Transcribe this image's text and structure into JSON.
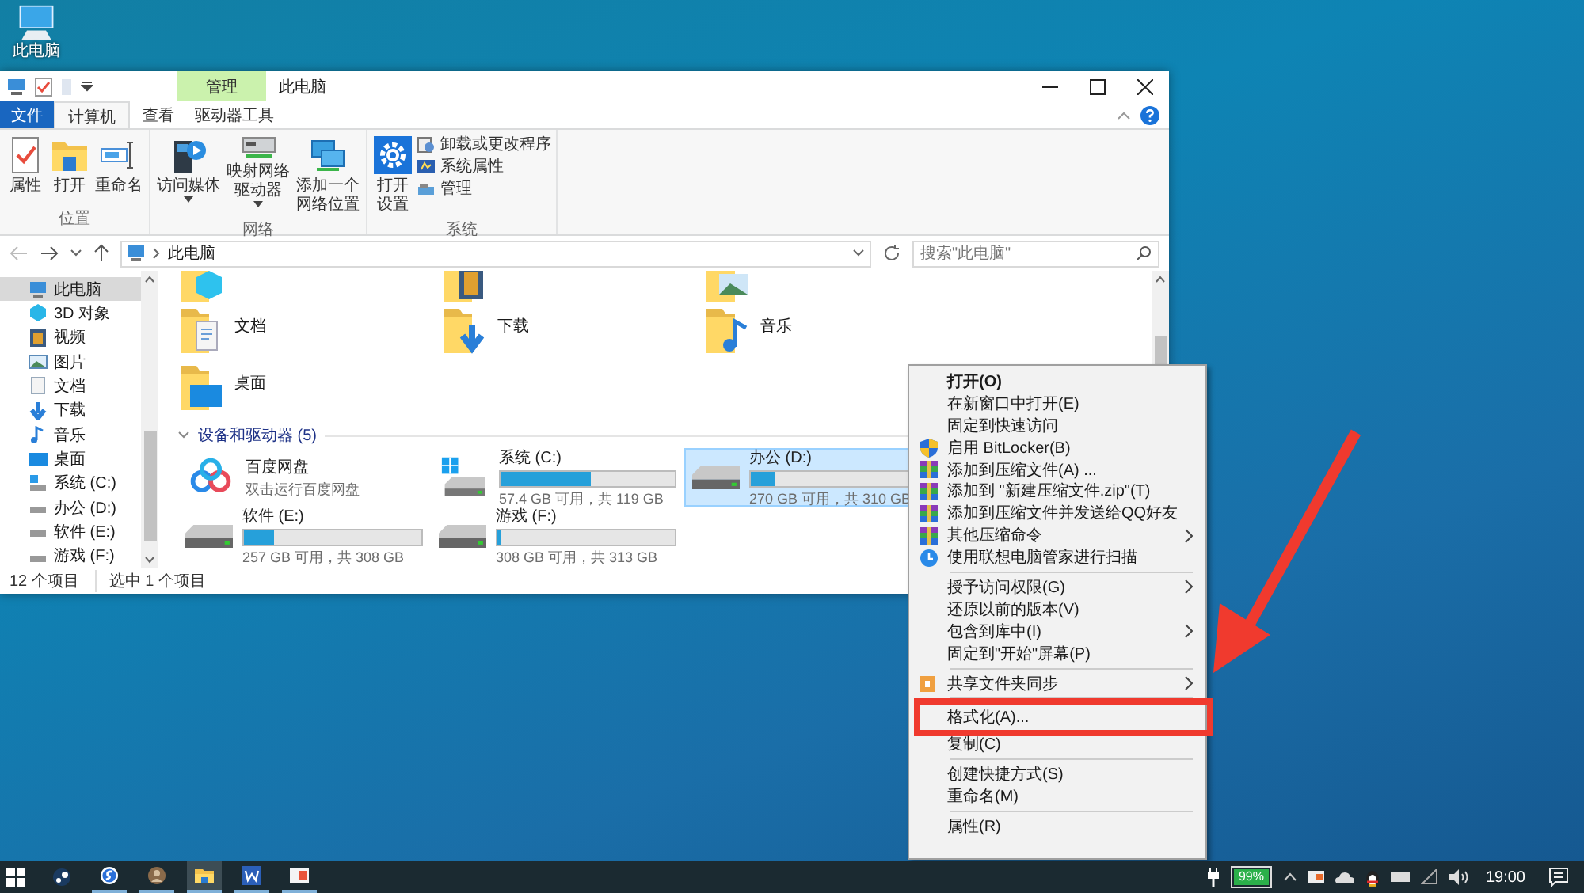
{
  "desktop_icons": [
    {
      "label": "此电脑"
    }
  ],
  "window": {
    "title": "此电脑",
    "context_tab": "管理"
  },
  "ribbon_tabs": [
    {
      "label": "文件",
      "kind": "file",
      "selected": false
    },
    {
      "label": "计算机",
      "kind": "tab",
      "selected": true
    },
    {
      "label": "查看",
      "kind": "tab",
      "selected": false
    },
    {
      "label": "驱动器工具",
      "kind": "context",
      "selected": false
    }
  ],
  "ribbon_groups": [
    {
      "label": "位置",
      "large_buttons": [
        {
          "lines": [
            "属性"
          ],
          "dropdown": false
        },
        {
          "lines": [
            "打开"
          ],
          "dropdown": false
        },
        {
          "lines": [
            "重命名"
          ],
          "dropdown": false
        }
      ]
    },
    {
      "label": "网络",
      "large_buttons": [
        {
          "lines": [
            "访问媒体"
          ],
          "dropdown": true
        },
        {
          "lines": [
            "映射网络",
            "驱动器"
          ],
          "dropdown": true
        },
        {
          "lines": [
            "添加一个",
            "网络位置"
          ],
          "dropdown": false
        }
      ]
    },
    {
      "label": "系统",
      "large_buttons": [
        {
          "lines": [
            "打开",
            "设置"
          ],
          "dropdown": false
        }
      ],
      "small_buttons": [
        {
          "label": "卸载或更改程序"
        },
        {
          "label": "系统属性"
        },
        {
          "label": "管理"
        }
      ]
    }
  ],
  "address": {
    "path": "此电脑",
    "search_placeholder": "搜索\"此电脑\""
  },
  "nav_items": [
    {
      "label": "此电脑",
      "selected": true
    },
    {
      "label": "3D 对象",
      "selected": false
    },
    {
      "label": "视频",
      "selected": false
    },
    {
      "label": "图片",
      "selected": false
    },
    {
      "label": "文档",
      "selected": false
    },
    {
      "label": "下载",
      "selected": false
    },
    {
      "label": "音乐",
      "selected": false
    },
    {
      "label": "桌面",
      "selected": false
    },
    {
      "label": "系统 (C:)",
      "selected": false
    },
    {
      "label": "办公 (D:)",
      "selected": false
    },
    {
      "label": "软件 (E:)",
      "selected": false
    },
    {
      "label": "游戏 (F:)",
      "selected": false
    }
  ],
  "folders": [
    {
      "cut": true
    },
    {
      "cut": true
    },
    {
      "cut": true
    },
    {
      "label": "文档",
      "cut": false
    },
    {
      "label": "下载",
      "cut": false
    },
    {
      "label": "音乐",
      "cut": false
    },
    {
      "label": "桌面",
      "cut": false
    }
  ],
  "devices_section": {
    "label": "设备和驱动器 (5)",
    "expanded": true
  },
  "drives": [
    {
      "kind": "app",
      "name": "百度网盘",
      "subtitle": "双击运行百度网盘",
      "selected": false
    },
    {
      "kind": "drive",
      "name": "系统 (C:)",
      "level": 0.52,
      "reading": "57.4 GB 可用，共 119 GB",
      "selected": false
    },
    {
      "kind": "drive",
      "name": "办公 (D:)",
      "level": 0.13,
      "reading": "270 GB 可用，共 310 GB",
      "selected": true
    },
    {
      "kind": "drive",
      "name": "软件 (E:)",
      "level": 0.17,
      "reading": "257 GB 可用，共 308 GB",
      "selected": false
    },
    {
      "kind": "drive",
      "name": "游戏 (F:)",
      "level": 0.02,
      "reading": "308 GB 可用，共 313 GB",
      "selected": false
    }
  ],
  "status_bar": {
    "item_count": "12 个项目",
    "selection": "选中 1 个项目"
  },
  "context_menu": [
    {
      "kind": "item",
      "label": "打开(O)",
      "default": true,
      "submenu": false,
      "highlighted": false
    },
    {
      "kind": "item",
      "label": "在新窗口中打开(E)",
      "default": false,
      "submenu": false,
      "highlighted": false
    },
    {
      "kind": "item",
      "label": "固定到快速访问",
      "default": false,
      "submenu": false,
      "highlighted": false
    },
    {
      "kind": "item",
      "label": "启用 BitLocker(B)",
      "default": false,
      "submenu": false,
      "highlighted": false
    },
    {
      "kind": "item",
      "label": "添加到压缩文件(A) ...",
      "default": false,
      "submenu": false,
      "highlighted": false
    },
    {
      "kind": "item",
      "label": "添加到 \"新建压缩文件.zip\"(T)",
      "default": false,
      "submenu": false,
      "highlighted": false
    },
    {
      "kind": "item",
      "label": "添加到压缩文件并发送给QQ好友",
      "default": false,
      "submenu": false,
      "highlighted": false
    },
    {
      "kind": "item",
      "label": "其他压缩命令",
      "default": false,
      "submenu": true,
      "highlighted": false
    },
    {
      "kind": "item",
      "label": "使用联想电脑管家进行扫描",
      "default": false,
      "submenu": false,
      "highlighted": false
    },
    {
      "kind": "separator"
    },
    {
      "kind": "item",
      "label": "授予访问权限(G)",
      "default": false,
      "submenu": true,
      "highlighted": false
    },
    {
      "kind": "item",
      "label": "还原以前的版本(V)",
      "default": false,
      "submenu": false,
      "highlighted": false
    },
    {
      "kind": "item",
      "label": "包含到库中(I)",
      "default": false,
      "submenu": true,
      "highlighted": false
    },
    {
      "kind": "item",
      "label": "固定到\"开始\"屏幕(P)",
      "default": false,
      "submenu": false,
      "highlighted": false
    },
    {
      "kind": "separator"
    },
    {
      "kind": "item",
      "label": "共享文件夹同步",
      "default": false,
      "submenu": true,
      "highlighted": false
    },
    {
      "kind": "separator"
    },
    {
      "kind": "item",
      "label": "格式化(A)...",
      "default": false,
      "submenu": false,
      "highlighted": true
    },
    {
      "kind": "item",
      "label": "复制(C)",
      "default": false,
      "submenu": false,
      "highlighted": false
    },
    {
      "kind": "separator"
    },
    {
      "kind": "item",
      "label": "创建快捷方式(S)",
      "default": false,
      "submenu": false,
      "highlighted": false
    },
    {
      "kind": "item",
      "label": "重命名(M)",
      "default": false,
      "submenu": false,
      "highlighted": false
    },
    {
      "kind": "separator"
    },
    {
      "kind": "item",
      "label": "属性(R)",
      "default": false,
      "submenu": false,
      "highlighted": false
    }
  ],
  "taskbar": {
    "apps": [
      {
        "running": false,
        "active": false
      },
      {
        "running": true,
        "active": false
      },
      {
        "running": true,
        "active": false
      },
      {
        "running": true,
        "active": true
      },
      {
        "running": true,
        "active": false
      },
      {
        "running": true,
        "active": false
      }
    ],
    "battery": "99%",
    "time": "19:00"
  }
}
